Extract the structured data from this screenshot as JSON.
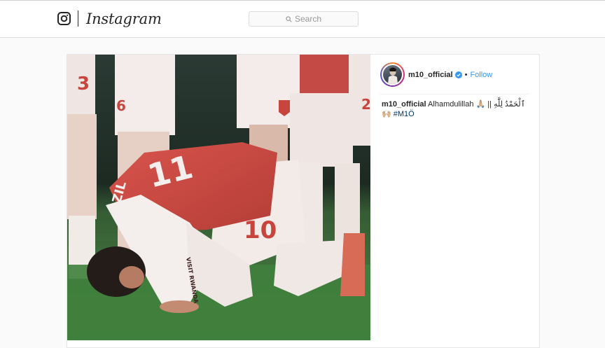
{
  "app": {
    "name": "Instagram",
    "icons": {
      "logo": "instagram-camera-icon",
      "search": "magnifier-icon",
      "verified": "verified-badge-icon"
    }
  },
  "search": {
    "placeholder": "Search"
  },
  "post": {
    "username": "m10_official",
    "separator": "•",
    "follow_label": "Follow",
    "caption": {
      "user": "m10_official",
      "text": "Alhamdulillah 🙏🏼 || ٱلْحَمْدُ لِلَّٰهِ",
      "emoji": "🙌🏼",
      "hashtag": "#M1Ö"
    },
    "photo": {
      "player_name_jersey": "ÖZIL",
      "player_number": "11",
      "shorts_number": "10",
      "sleeve_sponsor": "VISIT RWANDA",
      "teammate_number_left": "3",
      "teammate_number_right": "6",
      "teammate_number_far_right": "2"
    }
  },
  "colors": {
    "accent_blue": "#3897f0",
    "hashtag_blue": "#003569",
    "arsenal_red": "#c8453e",
    "pitch_green": "#3f7f3c"
  }
}
